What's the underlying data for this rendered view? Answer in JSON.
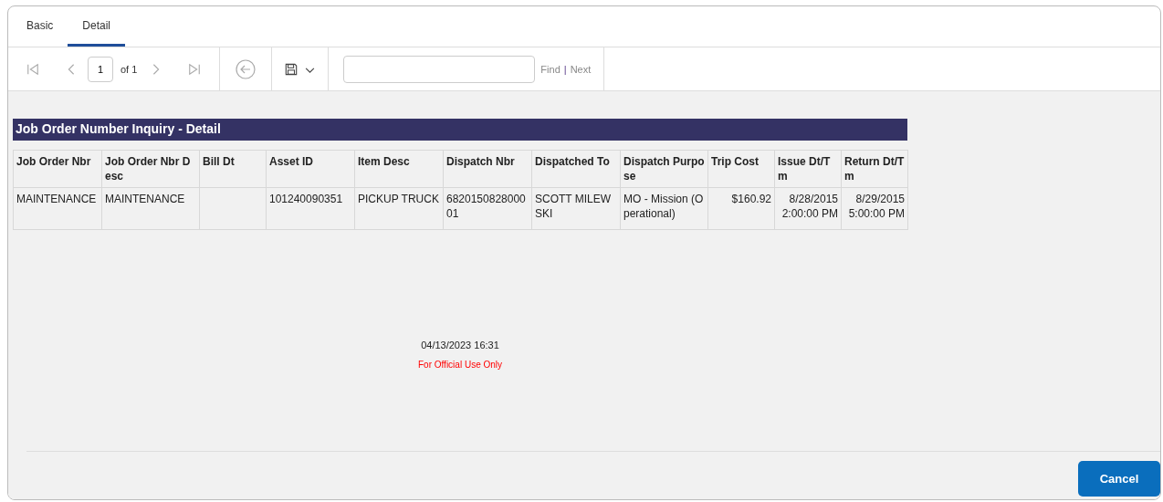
{
  "tabs": [
    {
      "label": "Basic",
      "selected": false
    },
    {
      "label": "Detail",
      "selected": true
    }
  ],
  "toolbar": {
    "page": "1",
    "page_of": "of 1",
    "find": "Find",
    "separator": "|",
    "next": "Next"
  },
  "report": {
    "title": "Job Order Number Inquiry - Detail",
    "columns": [
      {
        "label": "Job Order Nbr",
        "kind": "text"
      },
      {
        "label": "Job Order Nbr Desc",
        "kind": "text"
      },
      {
        "label": "Bill Dt",
        "kind": "text"
      },
      {
        "label": "Asset ID",
        "kind": "text"
      },
      {
        "label": "Item Desc",
        "kind": "text"
      },
      {
        "label": "Dispatch Nbr",
        "kind": "text"
      },
      {
        "label": "Dispatched To",
        "kind": "text"
      },
      {
        "label": "Dispatch Purpose",
        "kind": "text"
      },
      {
        "label": "Trip Cost",
        "kind": "number"
      },
      {
        "label": "Issue Dt/Tm",
        "kind": "number"
      },
      {
        "label": "Return Dt/Tm",
        "kind": "number"
      }
    ],
    "rows": [
      [
        "MAINTENANCE",
        "MAINTENANCE",
        "",
        "101240090351",
        "PICKUP TRUCK",
        "682015082800001",
        "SCOTT MILEWSKI",
        "MO - Mission (Operational)",
        "$160.92",
        "8/28/2015 2:00:00 PM",
        "8/29/2015 5:00:00 PM"
      ]
    ],
    "timestamp": "04/13/2023 16:31",
    "notice": "For Official Use Only"
  },
  "buttons": [
    "Cancel"
  ]
}
